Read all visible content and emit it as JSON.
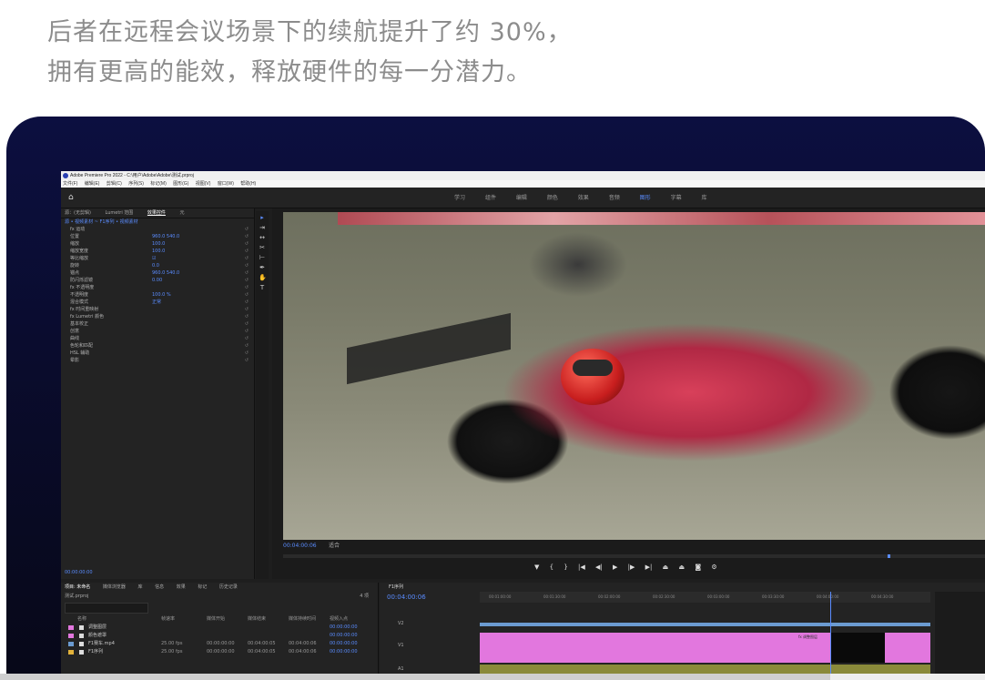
{
  "marketing": {
    "line1": "后者在远程会议场景下的续航提升了约 30%，",
    "line2": "拥有更高的能效，释放硬件的每一分潜力。"
  },
  "app": {
    "title": "Adobe Premiere Pro 2022 - C:\\用户\\Adobe\\Adobe\\测试.prproj",
    "menu": [
      "文件(F)",
      "编辑(E)",
      "剪辑(C)",
      "序列(S)",
      "标记(M)",
      "图形(G)",
      "视图(V)",
      "窗口(W)",
      "帮助(H)"
    ],
    "workspaces": [
      "学习",
      "组件",
      "编辑",
      "颜色",
      "效果",
      "音频",
      "图形",
      "字幕",
      "库"
    ],
    "active_workspace": "图形"
  },
  "effect_controls": {
    "tabs": [
      "源：(无剪辑)",
      "Lumetri 范围",
      "效果控件",
      "元"
    ],
    "active_tab": "效果控件",
    "sub": "源 • 视频素材  ~  F1序列 • 视频素材",
    "rows": [
      {
        "label": "fx 运动",
        "value": ""
      },
      {
        "label": "位置",
        "value": "960.0   540.0"
      },
      {
        "label": "缩放",
        "value": "100.0"
      },
      {
        "label": "缩放宽度",
        "value": "100.0"
      },
      {
        "label": "等比缩放",
        "value": "☑"
      },
      {
        "label": "旋转",
        "value": "0.0"
      },
      {
        "label": "锚点",
        "value": "960.0   540.0"
      },
      {
        "label": "防闪烁滤镜",
        "value": "0.00"
      },
      {
        "label": "fx 不透明度",
        "value": ""
      },
      {
        "label": "不透明度",
        "value": "100.0 %"
      },
      {
        "label": "混合模式",
        "value": "正常"
      },
      {
        "label": "fx 时间重映射",
        "value": ""
      },
      {
        "label": "fx Lumetri 颜色",
        "value": ""
      },
      {
        "label": "基本校正",
        "value": ""
      },
      {
        "label": "创意",
        "value": ""
      },
      {
        "label": "曲线",
        "value": ""
      },
      {
        "label": "色轮和匹配",
        "value": ""
      },
      {
        "label": "HSL 辅助",
        "value": ""
      },
      {
        "label": "晕影",
        "value": ""
      }
    ],
    "footer_timecode": "00:00:00:00"
  },
  "program_monitor": {
    "timecode": "00:04:00:06",
    "fit": "适合"
  },
  "project": {
    "tabs": [
      "项目: 未命名",
      "媒体浏览器",
      "库",
      "信息",
      "效果",
      "标记",
      "历史记录"
    ],
    "active_tab": "项目: 未命名",
    "file": "测试.prproj",
    "item_count": "4 项",
    "columns": [
      "名称",
      "帧速率",
      "媒体开始",
      "媒体结束",
      "媒体持续时间",
      "视频入点"
    ],
    "items": [
      {
        "name": "调整图层",
        "fps": "",
        "start": "",
        "end": "",
        "dur": "",
        "in": "00:00:00:00",
        "color": "#e277de"
      },
      {
        "name": "颜色遮罩",
        "fps": "",
        "start": "",
        "end": "",
        "dur": "",
        "in": "00:00:00:00",
        "color": "#e277de"
      },
      {
        "name": "F1赛车.mp4",
        "fps": "25.00 fps",
        "start": "00:00:00:00",
        "end": "00:04:00:05",
        "dur": "00:04:00:06",
        "in": "00:00:00:00",
        "color": "#6b9bd1"
      },
      {
        "name": "F1序列",
        "fps": "25.00 fps",
        "start": "00:00:00:00",
        "end": "00:04:00:05",
        "dur": "00:04:00:06",
        "in": "00:00:00:00",
        "color": "#e2b23a"
      }
    ]
  },
  "timeline": {
    "tab": "F1序列",
    "timecode": "00:04:00:06",
    "ruler": [
      "00:01:00:00",
      "00:01:30:00",
      "00:02:00:00",
      "00:02:30:00",
      "00:03:00:00",
      "00:03:30:00",
      "00:04:00:00",
      "00:04:30:00"
    ],
    "tracks": [
      "V2",
      "V1",
      "A1"
    ],
    "clip_label": "fx 调整图层"
  }
}
